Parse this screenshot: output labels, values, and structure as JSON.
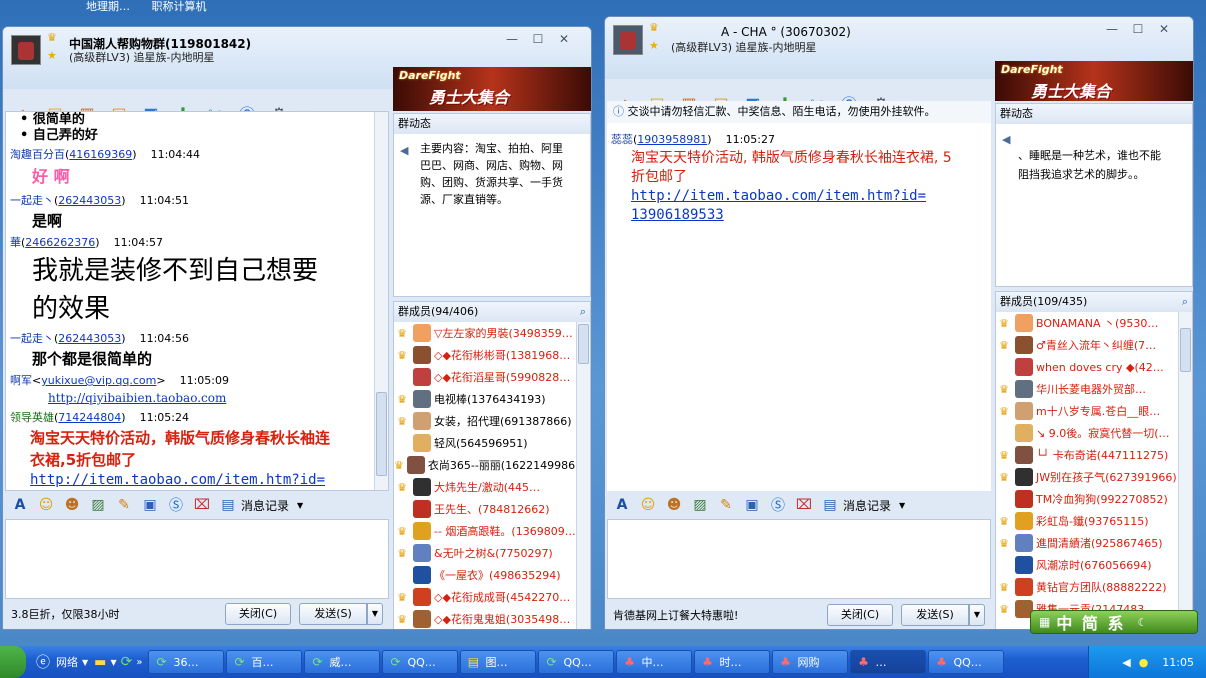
{
  "desktop": {
    "top_icons": [
      "地理期…",
      "职称计算机"
    ]
  },
  "left_window": {
    "title": "中国潮人帮购物群(119801842)",
    "subtitle": "(高级群LV3) 追星族-内地明星",
    "banner_top": "DareFight",
    "banner_main": "勇士大集合",
    "messages": [
      {
        "kind": "text",
        "text": "• 很简单的",
        "style": "bold"
      },
      {
        "kind": "text",
        "text": "• 自己弄的好",
        "style": "bold"
      },
      {
        "kind": "head",
        "name": "淘趣百分百",
        "id": "416169369",
        "time": "11:04:44"
      },
      {
        "kind": "text",
        "text": "好 啊",
        "style": "pink"
      },
      {
        "kind": "head",
        "name": "一起走丶",
        "id": "262443053",
        "time": "11:04:51"
      },
      {
        "kind": "text",
        "text": "是啊",
        "style": "boldbig"
      },
      {
        "kind": "head",
        "name": "華",
        "id": "2466262376",
        "time": "11:04:57"
      },
      {
        "kind": "text",
        "text": "我就是装修不到自己想要",
        "style": "huge"
      },
      {
        "kind": "text",
        "text": "的效果",
        "style": "huge"
      },
      {
        "kind": "head",
        "name": "一起走丶",
        "id": "262443053",
        "time": "11:04:56"
      },
      {
        "kind": "text",
        "text": "那个都是很简单的",
        "style": "boldbig"
      },
      {
        "kind": "head",
        "name": "啊军",
        "id": "yukixue@vip.qq.com",
        "time": "11:05:09",
        "angle": true
      },
      {
        "kind": "link",
        "text": "http://qiyibaibien.taobao.com",
        "style": "small"
      },
      {
        "kind": "head",
        "name": "领导英雄",
        "id": "714244804",
        "time": "11:05:24",
        "green": true
      },
      {
        "kind": "text",
        "text": "淘宝天天特价活动，韩版气质修身春秋长袖连",
        "style": "redbold"
      },
      {
        "kind": "text",
        "text": "衣裙,5折包邮了",
        "style": "redbold"
      },
      {
        "kind": "link",
        "text": "http://item.taobao.com/item.htm?id=",
        "style": "big"
      },
      {
        "kind": "link",
        "text": "13906189533",
        "style": "big"
      }
    ],
    "dynamic_header": "群动态",
    "dynamic_lines": [
      "主要内容：淘宝、拍拍、阿里",
      "巴巴、网商、网店、购物、网",
      "购、团购、货源共享、一手货",
      "源、厂家直销等。"
    ],
    "members_header": "群成员(94/406)",
    "members": [
      {
        "name": "▽左左家的男裝(3498359…",
        "color": "#d8200e"
      },
      {
        "name": "◇◆花衔彬彬哥(1381968…",
        "color": "#d8200e"
      },
      {
        "name": "◇◆花衔滔星哥(5990828…",
        "color": "#d8200e"
      },
      {
        "name": "电视棒(1376434193)",
        "color": "#000000"
      },
      {
        "name": "女装，招代理(691387866)",
        "color": "#000000"
      },
      {
        "name": "轻风(564596951)",
        "color": "#000000"
      },
      {
        "name": "衣尚365--丽丽(1622149986)",
        "color": "#000000"
      },
      {
        "name": "大炜先生/激动(445…",
        "color": "#d8200e"
      },
      {
        "name": "王先生、(784812662)",
        "color": "#d8200e"
      },
      {
        "name": "-- 烟酒高跟鞋。(1369809…",
        "color": "#d8200e"
      },
      {
        "name": "&无叶之树&(7750297)",
        "color": "#d8200e"
      },
      {
        "name": "《一屋衣》(498635294)",
        "color": "#d8200e"
      },
      {
        "name": "◇◆花衔成成哥(4542270…",
        "color": "#d8200e"
      },
      {
        "name": "◇◆花衔鬼鬼姐(3035498…",
        "color": "#d8200e"
      }
    ],
    "format_bar_label": "消息记录",
    "status_text": "3.8巨折，仅限38小时",
    "close_button": "关闭(C)",
    "send_button": "发送(S)"
  },
  "right_window": {
    "title": "A - CHA ° (30670302)",
    "subtitle": "(高级群LV3) 追星族-内地明星",
    "notice": "交谈中请勿轻信汇款、中奖信息、陌生电话，勿使用外挂软件。",
    "messages": [
      {
        "kind": "head",
        "name": "蕊蕊",
        "id": "1903958981",
        "time": "11:05:27"
      },
      {
        "kind": "text",
        "text": "淘宝天天特价活动, 韩版气质修身春秋长袖连衣裙, 5",
        "style": "red"
      },
      {
        "kind": "text",
        "text": "折包邮了",
        "style": "red"
      },
      {
        "kind": "link",
        "text": "http://item.taobao.com/item.htm?id=",
        "style": "big"
      },
      {
        "kind": "link",
        "text": "13906189533",
        "style": "big"
      }
    ],
    "dynamic_header": "群动态",
    "dynamic_lines": [
      "、睡眠是一种艺术，谁也不能",
      "阻挡我追求艺术的脚步。。"
    ],
    "members_header": "群成员(109/435)",
    "members": [
      {
        "name": "BONAMANA 丶(9530…",
        "color": "#d8200e"
      },
      {
        "name": "♂青丝入流年丶纠缠(7…",
        "color": "#d8200e"
      },
      {
        "name": "when doves cry ◆(42…",
        "color": "#d8200e"
      },
      {
        "name": "华川长菱电器外贸部…",
        "color": "#d8200e"
      },
      {
        "name": "m十八岁专属.苍白__眼…",
        "color": "#d8200e"
      },
      {
        "name": "↘ 9.0後。寂寞代替一切(…",
        "color": "#d8200e"
      },
      {
        "name": "└┘ 卡布奇诺(447111275)",
        "color": "#d8200e"
      },
      {
        "name": "JW别在孩子气(627391966)",
        "color": "#d8200e"
      },
      {
        "name": "TM冷血狗狗(992270852)",
        "color": "#d8200e"
      },
      {
        "name": "彩虹岛-鑯(93765115)",
        "color": "#d8200e"
      },
      {
        "name": "進間清績渚(925867465)",
        "color": "#d8200e"
      },
      {
        "name": "风潮凉时(676056694)",
        "color": "#d8200e"
      },
      {
        "name": "黄钻官方团队(88882222)",
        "color": "#d8200e"
      },
      {
        "name": "雅集一元贡(2147483…",
        "color": "#d8200e"
      }
    ],
    "format_bar_label": "消息记录",
    "status_text": "肯德基网上订餐大特惠啦!",
    "close_button": "关闭(C)",
    "send_button": "发送(S)"
  },
  "ime": {
    "label": "中 简 系"
  },
  "taskbar": {
    "network_label": "网络",
    "items": [
      "36…",
      "百…",
      "威…",
      "QQ…",
      "图…",
      "QQ…",
      "中…",
      "时…",
      "网购",
      "…",
      "QQ…"
    ],
    "clock": "11:05"
  }
}
